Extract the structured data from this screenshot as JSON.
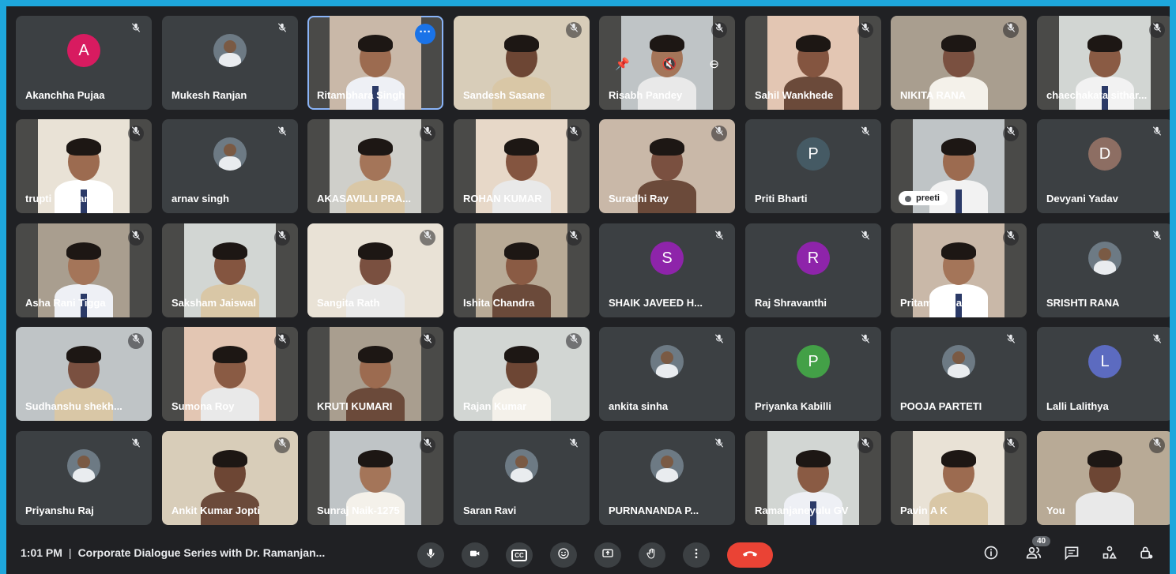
{
  "colors": {
    "frame": "#1ea7dc",
    "background": "#202124",
    "tile": "#3c4043",
    "end_call": "#ea4335",
    "menu_blue": "#1a73e8"
  },
  "tiles": [
    {
      "name": "Akanchha Pujaa",
      "kind": "avatar",
      "letter": "A",
      "color": "#d81b60"
    },
    {
      "name": "Mukesh Ranjan",
      "kind": "photo-avatar"
    },
    {
      "name": "Ritambhara Singh",
      "kind": "video",
      "active": true
    },
    {
      "name": "Sandesh Sasane",
      "kind": "video"
    },
    {
      "name": "Risabh Pandey",
      "kind": "video",
      "overlay": true
    },
    {
      "name": "Sahil Wankhede",
      "kind": "video"
    },
    {
      "name": "NIKITA RANA",
      "kind": "video"
    },
    {
      "name": "chaechakata sithar...",
      "kind": "video"
    },
    {
      "name": "trupti gadkari",
      "kind": "video"
    },
    {
      "name": "arnav singh",
      "kind": "photo-avatar"
    },
    {
      "name": "AKASAVILLI PRA...",
      "kind": "video"
    },
    {
      "name": "ROHAN KUMAR",
      "kind": "video"
    },
    {
      "name": "Suradhi Ray",
      "kind": "video"
    },
    {
      "name": "Priti Bharti",
      "kind": "avatar",
      "letter": "P",
      "color": "#455a64"
    },
    {
      "name": "preeti",
      "kind": "video",
      "pill": true
    },
    {
      "name": "Devyani Yadav",
      "kind": "avatar",
      "letter": "D",
      "color": "#8d6e63"
    },
    {
      "name": "Asha Rani Tigga",
      "kind": "video"
    },
    {
      "name": "Saksham Jaiswal",
      "kind": "video"
    },
    {
      "name": "Sangita Rath",
      "kind": "video"
    },
    {
      "name": "Ishita Chandra",
      "kind": "video"
    },
    {
      "name": "SHAIK JAVEED H...",
      "kind": "avatar",
      "letter": "S",
      "color": "#8e24aa"
    },
    {
      "name": "Raj Shravanthi",
      "kind": "avatar",
      "letter": "R",
      "color": "#8e24aa"
    },
    {
      "name": "Pritam Mohanty",
      "kind": "video"
    },
    {
      "name": "SRISHTI RANA",
      "kind": "photo-avatar"
    },
    {
      "name": "Sudhanshu shekh...",
      "kind": "video"
    },
    {
      "name": "Sumona Roy",
      "kind": "video"
    },
    {
      "name": "KRUTI KUMARI",
      "kind": "video"
    },
    {
      "name": "Rajan Kumar",
      "kind": "video"
    },
    {
      "name": "ankita sinha",
      "kind": "photo-avatar"
    },
    {
      "name": "Priyanka Kabilli",
      "kind": "avatar",
      "letter": "P",
      "color": "#43a047"
    },
    {
      "name": "POOJA PARTETI",
      "kind": "photo-avatar"
    },
    {
      "name": "Lalli Lalithya",
      "kind": "avatar",
      "letter": "L",
      "color": "#5c6bc0"
    },
    {
      "name": "Priyanshu Raj",
      "kind": "photo-avatar"
    },
    {
      "name": "Ankit Kumar Jopti",
      "kind": "video"
    },
    {
      "name": "Sunraj Naik-1275",
      "kind": "video"
    },
    {
      "name": "Saran Ravi",
      "kind": "photo-avatar"
    },
    {
      "name": "PURNANANDA P...",
      "kind": "photo-avatar"
    },
    {
      "name": "Ramanjaneyulu GV",
      "kind": "video"
    },
    {
      "name": "Pavin A K",
      "kind": "video"
    },
    {
      "name": "You",
      "kind": "video"
    }
  ],
  "bottom_bar": {
    "time": "1:01 PM",
    "separator": "|",
    "meeting_title": "Corporate Dialogue Series with Dr. Ramanjan...",
    "participant_count": "40",
    "controls": [
      "mic-icon",
      "camera-icon",
      "captions-icon",
      "emoji-icon",
      "present-icon",
      "raise-hand-icon",
      "more-options-icon",
      "end-call-icon"
    ],
    "captions_label": "CC",
    "right_icons": [
      "info-icon",
      "people-icon",
      "chat-icon",
      "activities-icon",
      "host-controls-icon"
    ]
  }
}
